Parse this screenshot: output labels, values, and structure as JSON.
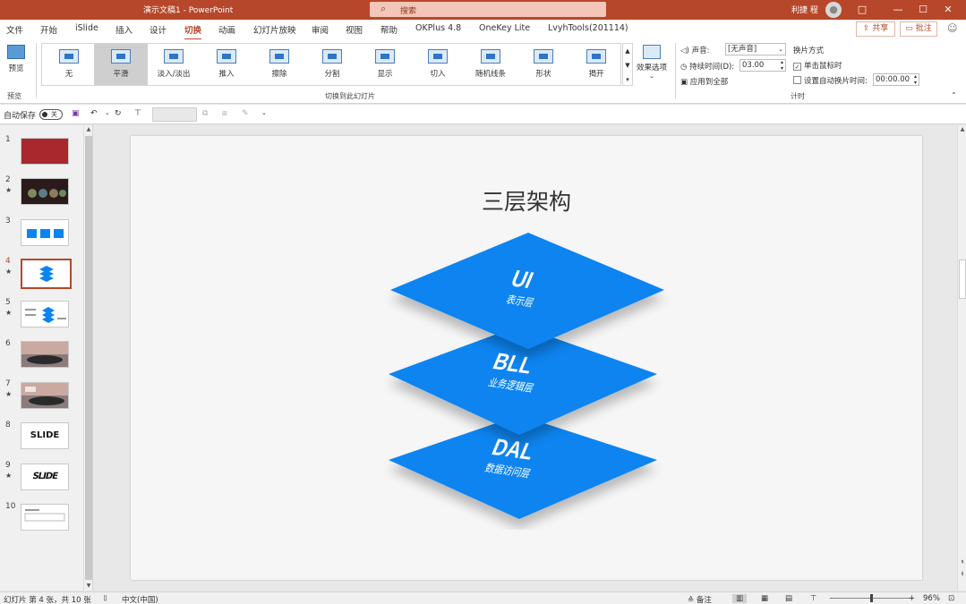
{
  "titlebar": {
    "doc_title": "演示文稿1  -  PowerPoint",
    "search_placeholder": "搜索",
    "user": "利捷 程",
    "minimize": "—",
    "ribbon_display": "□",
    "maximize": "☐",
    "close": "✕"
  },
  "menu": {
    "tabs": [
      "文件",
      "开始",
      "iSlide",
      "插入",
      "设计",
      "切换",
      "动画",
      "幻灯片放映",
      "审阅",
      "视图",
      "帮助",
      "OKPlus 4.8",
      "OneKey Lite",
      "LvyhTools(201114)"
    ],
    "active": "切换",
    "share": "共享",
    "comment": "批注"
  },
  "ribbon": {
    "preview_label": "预览",
    "preview_group": "预览",
    "transitions_group": "切换到此幻灯片",
    "transitions": [
      {
        "label": "无"
      },
      {
        "label": "平滑"
      },
      {
        "label": "淡入/淡出"
      },
      {
        "label": "推入"
      },
      {
        "label": "擦除"
      },
      {
        "label": "分割"
      },
      {
        "label": "显示"
      },
      {
        "label": "切入"
      },
      {
        "label": "随机线条"
      },
      {
        "label": "形状"
      },
      {
        "label": "揭开"
      }
    ],
    "selected_transition": "平滑",
    "effect_options": "效果选项",
    "timing": {
      "sound_label": "声音:",
      "sound_value": "[无声音]",
      "duration_label": "持续时间(D):",
      "duration_value": "03.00",
      "apply_all": "应用到全部",
      "advance_title": "换片方式",
      "on_click": "单击鼠标时",
      "after_label": "设置自动换片时间:",
      "after_value": "00:00.00",
      "group": "计时"
    }
  },
  "qat": {
    "autosave": "自动保存",
    "autosave_state": "关"
  },
  "thumbnails": [
    {
      "num": "1",
      "star": false
    },
    {
      "num": "2",
      "star": true
    },
    {
      "num": "3",
      "star": false
    },
    {
      "num": "4",
      "star": true,
      "active": true
    },
    {
      "num": "5",
      "star": true
    },
    {
      "num": "6",
      "star": false
    },
    {
      "num": "7",
      "star": true
    },
    {
      "num": "8",
      "star": false,
      "text": "SLIDE"
    },
    {
      "num": "9",
      "star": true,
      "text": "SLIDE"
    },
    {
      "num": "10",
      "star": false
    }
  ],
  "slide": {
    "title": "三层架构",
    "layers": [
      {
        "code": "UI",
        "name": "表示层"
      },
      {
        "code": "BLL",
        "name": "业务逻辑层"
      },
      {
        "code": "DAL",
        "name": "数据访问层"
      }
    ],
    "layer_color": "#0a84f0"
  },
  "status": {
    "slide_info": "幻灯片 第 4 张，共 10 张",
    "language": "中文(中国)",
    "notes": "备注",
    "zoom": "96%"
  }
}
